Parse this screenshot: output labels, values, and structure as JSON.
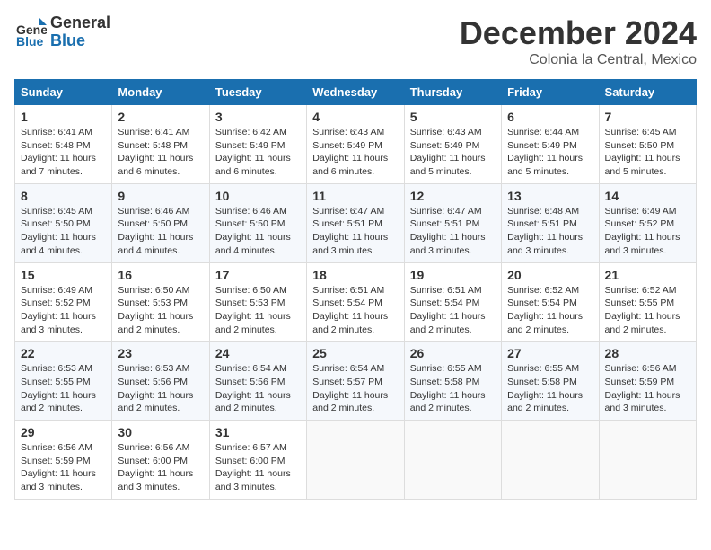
{
  "header": {
    "logo_line1": "General",
    "logo_line2": "Blue",
    "month": "December 2024",
    "location": "Colonia la Central, Mexico"
  },
  "days_of_week": [
    "Sunday",
    "Monday",
    "Tuesday",
    "Wednesday",
    "Thursday",
    "Friday",
    "Saturday"
  ],
  "weeks": [
    [
      {
        "day": 1,
        "info": "Sunrise: 6:41 AM\nSunset: 5:48 PM\nDaylight: 11 hours\nand 7 minutes."
      },
      {
        "day": 2,
        "info": "Sunrise: 6:41 AM\nSunset: 5:48 PM\nDaylight: 11 hours\nand 6 minutes."
      },
      {
        "day": 3,
        "info": "Sunrise: 6:42 AM\nSunset: 5:49 PM\nDaylight: 11 hours\nand 6 minutes."
      },
      {
        "day": 4,
        "info": "Sunrise: 6:43 AM\nSunset: 5:49 PM\nDaylight: 11 hours\nand 6 minutes."
      },
      {
        "day": 5,
        "info": "Sunrise: 6:43 AM\nSunset: 5:49 PM\nDaylight: 11 hours\nand 5 minutes."
      },
      {
        "day": 6,
        "info": "Sunrise: 6:44 AM\nSunset: 5:49 PM\nDaylight: 11 hours\nand 5 minutes."
      },
      {
        "day": 7,
        "info": "Sunrise: 6:45 AM\nSunset: 5:50 PM\nDaylight: 11 hours\nand 5 minutes."
      }
    ],
    [
      {
        "day": 8,
        "info": "Sunrise: 6:45 AM\nSunset: 5:50 PM\nDaylight: 11 hours\nand 4 minutes."
      },
      {
        "day": 9,
        "info": "Sunrise: 6:46 AM\nSunset: 5:50 PM\nDaylight: 11 hours\nand 4 minutes."
      },
      {
        "day": 10,
        "info": "Sunrise: 6:46 AM\nSunset: 5:50 PM\nDaylight: 11 hours\nand 4 minutes."
      },
      {
        "day": 11,
        "info": "Sunrise: 6:47 AM\nSunset: 5:51 PM\nDaylight: 11 hours\nand 3 minutes."
      },
      {
        "day": 12,
        "info": "Sunrise: 6:47 AM\nSunset: 5:51 PM\nDaylight: 11 hours\nand 3 minutes."
      },
      {
        "day": 13,
        "info": "Sunrise: 6:48 AM\nSunset: 5:51 PM\nDaylight: 11 hours\nand 3 minutes."
      },
      {
        "day": 14,
        "info": "Sunrise: 6:49 AM\nSunset: 5:52 PM\nDaylight: 11 hours\nand 3 minutes."
      }
    ],
    [
      {
        "day": 15,
        "info": "Sunrise: 6:49 AM\nSunset: 5:52 PM\nDaylight: 11 hours\nand 3 minutes."
      },
      {
        "day": 16,
        "info": "Sunrise: 6:50 AM\nSunset: 5:53 PM\nDaylight: 11 hours\nand 2 minutes."
      },
      {
        "day": 17,
        "info": "Sunrise: 6:50 AM\nSunset: 5:53 PM\nDaylight: 11 hours\nand 2 minutes."
      },
      {
        "day": 18,
        "info": "Sunrise: 6:51 AM\nSunset: 5:54 PM\nDaylight: 11 hours\nand 2 minutes."
      },
      {
        "day": 19,
        "info": "Sunrise: 6:51 AM\nSunset: 5:54 PM\nDaylight: 11 hours\nand 2 minutes."
      },
      {
        "day": 20,
        "info": "Sunrise: 6:52 AM\nSunset: 5:54 PM\nDaylight: 11 hours\nand 2 minutes."
      },
      {
        "day": 21,
        "info": "Sunrise: 6:52 AM\nSunset: 5:55 PM\nDaylight: 11 hours\nand 2 minutes."
      }
    ],
    [
      {
        "day": 22,
        "info": "Sunrise: 6:53 AM\nSunset: 5:55 PM\nDaylight: 11 hours\nand 2 minutes."
      },
      {
        "day": 23,
        "info": "Sunrise: 6:53 AM\nSunset: 5:56 PM\nDaylight: 11 hours\nand 2 minutes."
      },
      {
        "day": 24,
        "info": "Sunrise: 6:54 AM\nSunset: 5:56 PM\nDaylight: 11 hours\nand 2 minutes."
      },
      {
        "day": 25,
        "info": "Sunrise: 6:54 AM\nSunset: 5:57 PM\nDaylight: 11 hours\nand 2 minutes."
      },
      {
        "day": 26,
        "info": "Sunrise: 6:55 AM\nSunset: 5:58 PM\nDaylight: 11 hours\nand 2 minutes."
      },
      {
        "day": 27,
        "info": "Sunrise: 6:55 AM\nSunset: 5:58 PM\nDaylight: 11 hours\nand 2 minutes."
      },
      {
        "day": 28,
        "info": "Sunrise: 6:56 AM\nSunset: 5:59 PM\nDaylight: 11 hours\nand 3 minutes."
      }
    ],
    [
      {
        "day": 29,
        "info": "Sunrise: 6:56 AM\nSunset: 5:59 PM\nDaylight: 11 hours\nand 3 minutes."
      },
      {
        "day": 30,
        "info": "Sunrise: 6:56 AM\nSunset: 6:00 PM\nDaylight: 11 hours\nand 3 minutes."
      },
      {
        "day": 31,
        "info": "Sunrise: 6:57 AM\nSunset: 6:00 PM\nDaylight: 11 hours\nand 3 minutes."
      },
      null,
      null,
      null,
      null
    ]
  ]
}
